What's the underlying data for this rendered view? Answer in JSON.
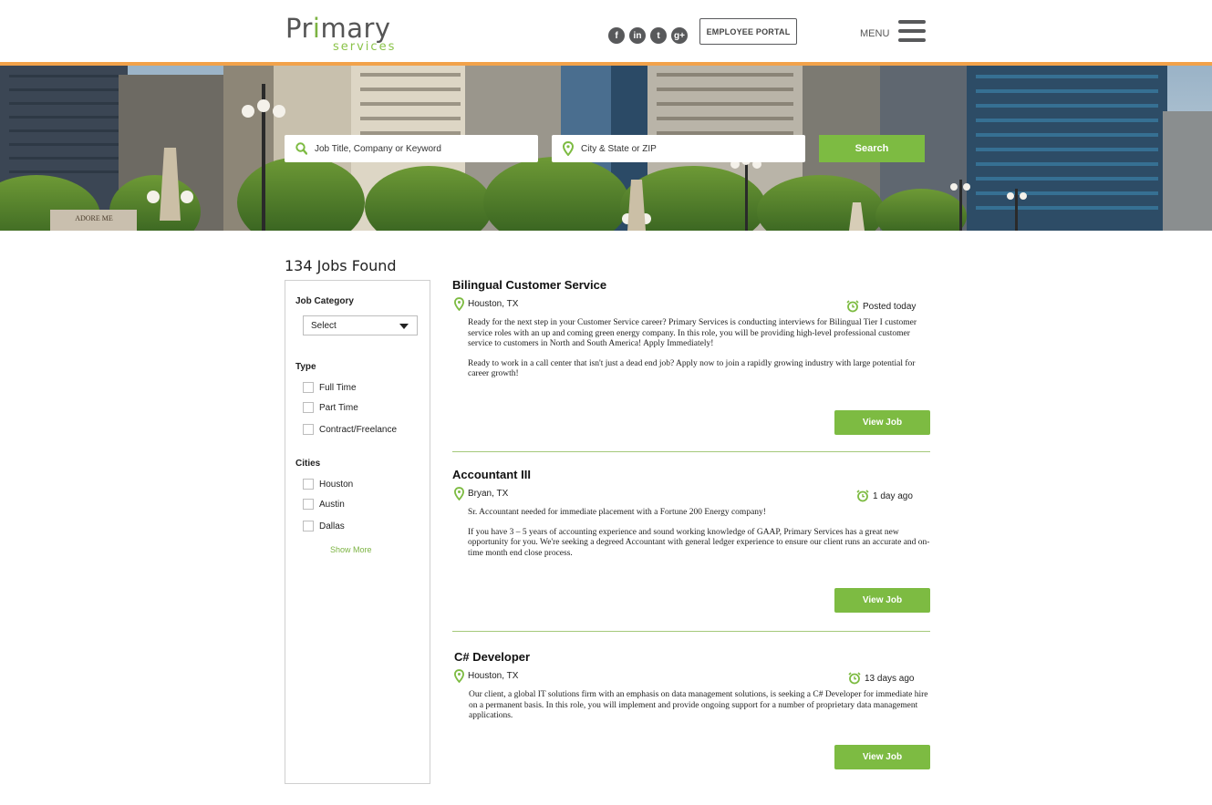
{
  "header": {
    "logo_main_pre": "Pr",
    "logo_main_fig": "i",
    "logo_main_post": "mary",
    "logo_sub": "services",
    "social": [
      {
        "icon": "facebook-icon",
        "glyph": "f"
      },
      {
        "icon": "linkedin-icon",
        "glyph": "in"
      },
      {
        "icon": "twitter-icon",
        "glyph": "t"
      },
      {
        "icon": "google-plus-icon",
        "glyph": "g+"
      }
    ],
    "employee_portal": "EMPLOYEE PORTAL",
    "menu_label": "MENU"
  },
  "search": {
    "keyword_placeholder": "Job Title, Company or Keyword",
    "location_placeholder": "City & State or ZIP",
    "button_label": "Search"
  },
  "results": {
    "count_label": "134 Jobs Found"
  },
  "filters": {
    "category": {
      "heading": "Job Category",
      "selected": "Select"
    },
    "type": {
      "heading": "Type",
      "options": [
        "Full Time",
        "Part Time",
        "Contract/Freelance"
      ]
    },
    "cities": {
      "heading": "Cities",
      "options": [
        "Houston",
        "Austin",
        "Dallas"
      ],
      "show_more": "Show More"
    }
  },
  "jobs": [
    {
      "title": "Bilingual Customer Service",
      "location": "Houston, TX",
      "posted": "Posted today",
      "description": [
        "Ready for the next step in your Customer Service career? Primary Services is conducting interviews for Bilingual Tier I customer service roles with an up and coming green energy company.  In this role, you will be providing high-level professional customer service to customers in North and South America! Apply Immediately!",
        "Ready to work in a call center that isn't just a dead end job? Apply now to join a rapidly growing industry with large potential for career growth!"
      ],
      "button": "View Job"
    },
    {
      "title": "Accountant III",
      "location": "Bryan, TX",
      "posted": "1 day ago",
      "description": [
        "Sr. Accountant needed for immediate placement with a Fortune 200 Energy company!",
        "If you have 3 – 5 years of accounting experience and sound working knowledge of GAAP, Primary Services has a great new opportunity for you. We're seeking a degreed Accountant with general ledger experience to ensure our client runs an accurate and on-time month end close process."
      ],
      "button": "View Job"
    },
    {
      "title": "C# Developer",
      "location": "Houston, TX",
      "posted": "13 days ago",
      "description": [
        "Our client, a global IT solutions firm with an emphasis on data management solutions, is seeking a C# Developer for immediate hire on a permanent basis. In this role, you will implement and provide ongoing support for a number of proprietary data management applications."
      ],
      "button": "View Job"
    }
  ],
  "colors": {
    "accent_green": "#7dbb42",
    "accent_orange": "#f2a24a",
    "icon_gray": "#58595b"
  }
}
